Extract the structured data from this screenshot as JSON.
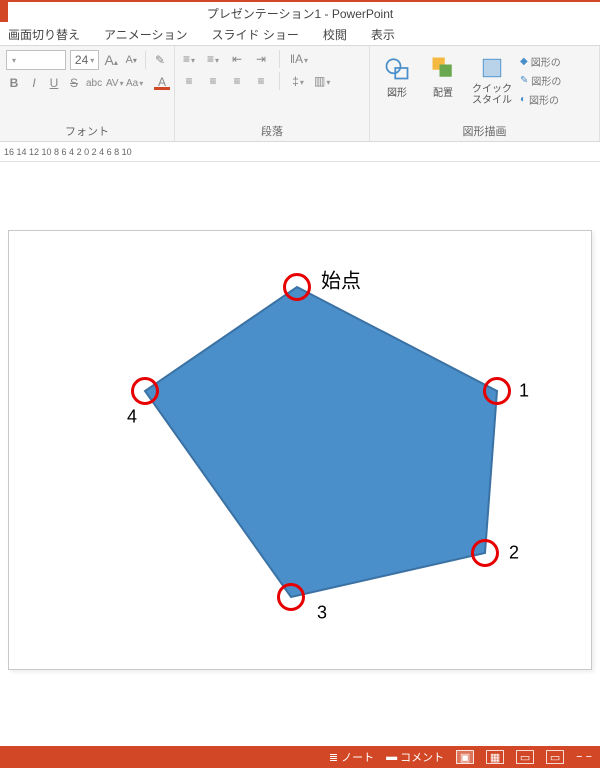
{
  "title": "プレゼンテーション1 - PowerPoint",
  "tabs": [
    "画面切り替え",
    "アニメーション",
    "スライド ショー",
    "校閲",
    "表示"
  ],
  "ribbon": {
    "font": {
      "size": "24",
      "grow": "A",
      "shrink": "A",
      "clear": "✎",
      "bold": "B",
      "italic": "I",
      "underline": "U",
      "strike": "S",
      "shadow": "abc",
      "spacing": "AV",
      "case": "Aa",
      "color": "A",
      "label": "フォント"
    },
    "para": {
      "label": "段落"
    },
    "draw": {
      "shapes": "図形",
      "arrange": "配置",
      "quick": "クイック\nスタイル",
      "fill": "図形の",
      "outline": "図形の",
      "effects": "図形の",
      "label": "図形描画"
    }
  },
  "ruler": "16      14      12      10        8        6        4        2        0        2        4        6        8       10",
  "annotations": {
    "start": "始点",
    "p1": "1",
    "p2": "2",
    "p3": "3",
    "p4": "4"
  },
  "status": {
    "notes": "ノート",
    "comments": "コメント"
  }
}
